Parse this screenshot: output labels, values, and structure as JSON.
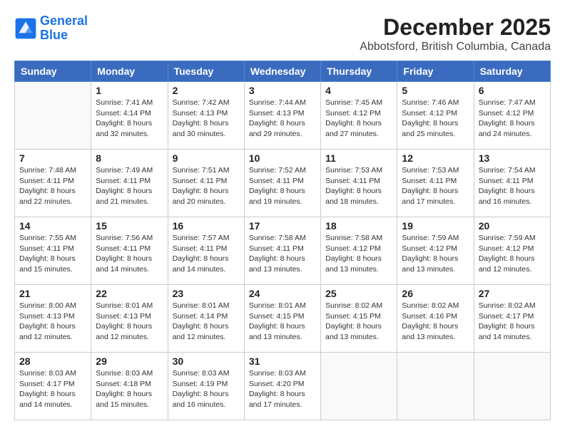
{
  "header": {
    "logo_line1": "General",
    "logo_line2": "Blue",
    "month": "December 2025",
    "location": "Abbotsford, British Columbia, Canada"
  },
  "days_of_week": [
    "Sunday",
    "Monday",
    "Tuesday",
    "Wednesday",
    "Thursday",
    "Friday",
    "Saturday"
  ],
  "weeks": [
    [
      {
        "day": "",
        "info": ""
      },
      {
        "day": "1",
        "info": "Sunrise: 7:41 AM\nSunset: 4:14 PM\nDaylight: 8 hours\nand 32 minutes."
      },
      {
        "day": "2",
        "info": "Sunrise: 7:42 AM\nSunset: 4:13 PM\nDaylight: 8 hours\nand 30 minutes."
      },
      {
        "day": "3",
        "info": "Sunrise: 7:44 AM\nSunset: 4:13 PM\nDaylight: 8 hours\nand 29 minutes."
      },
      {
        "day": "4",
        "info": "Sunrise: 7:45 AM\nSunset: 4:12 PM\nDaylight: 8 hours\nand 27 minutes."
      },
      {
        "day": "5",
        "info": "Sunrise: 7:46 AM\nSunset: 4:12 PM\nDaylight: 8 hours\nand 25 minutes."
      },
      {
        "day": "6",
        "info": "Sunrise: 7:47 AM\nSunset: 4:12 PM\nDaylight: 8 hours\nand 24 minutes."
      }
    ],
    [
      {
        "day": "7",
        "info": "Sunrise: 7:48 AM\nSunset: 4:11 PM\nDaylight: 8 hours\nand 22 minutes."
      },
      {
        "day": "8",
        "info": "Sunrise: 7:49 AM\nSunset: 4:11 PM\nDaylight: 8 hours\nand 21 minutes."
      },
      {
        "day": "9",
        "info": "Sunrise: 7:51 AM\nSunset: 4:11 PM\nDaylight: 8 hours\nand 20 minutes."
      },
      {
        "day": "10",
        "info": "Sunrise: 7:52 AM\nSunset: 4:11 PM\nDaylight: 8 hours\nand 19 minutes."
      },
      {
        "day": "11",
        "info": "Sunrise: 7:53 AM\nSunset: 4:11 PM\nDaylight: 8 hours\nand 18 minutes."
      },
      {
        "day": "12",
        "info": "Sunrise: 7:53 AM\nSunset: 4:11 PM\nDaylight: 8 hours\nand 17 minutes."
      },
      {
        "day": "13",
        "info": "Sunrise: 7:54 AM\nSunset: 4:11 PM\nDaylight: 8 hours\nand 16 minutes."
      }
    ],
    [
      {
        "day": "14",
        "info": "Sunrise: 7:55 AM\nSunset: 4:11 PM\nDaylight: 8 hours\nand 15 minutes."
      },
      {
        "day": "15",
        "info": "Sunrise: 7:56 AM\nSunset: 4:11 PM\nDaylight: 8 hours\nand 14 minutes."
      },
      {
        "day": "16",
        "info": "Sunrise: 7:57 AM\nSunset: 4:11 PM\nDaylight: 8 hours\nand 14 minutes."
      },
      {
        "day": "17",
        "info": "Sunrise: 7:58 AM\nSunset: 4:11 PM\nDaylight: 8 hours\nand 13 minutes."
      },
      {
        "day": "18",
        "info": "Sunrise: 7:58 AM\nSunset: 4:12 PM\nDaylight: 8 hours\nand 13 minutes."
      },
      {
        "day": "19",
        "info": "Sunrise: 7:59 AM\nSunset: 4:12 PM\nDaylight: 8 hours\nand 13 minutes."
      },
      {
        "day": "20",
        "info": "Sunrise: 7:59 AM\nSunset: 4:12 PM\nDaylight: 8 hours\nand 12 minutes."
      }
    ],
    [
      {
        "day": "21",
        "info": "Sunrise: 8:00 AM\nSunset: 4:13 PM\nDaylight: 8 hours\nand 12 minutes."
      },
      {
        "day": "22",
        "info": "Sunrise: 8:01 AM\nSunset: 4:13 PM\nDaylight: 8 hours\nand 12 minutes."
      },
      {
        "day": "23",
        "info": "Sunrise: 8:01 AM\nSunset: 4:14 PM\nDaylight: 8 hours\nand 12 minutes."
      },
      {
        "day": "24",
        "info": "Sunrise: 8:01 AM\nSunset: 4:15 PM\nDaylight: 8 hours\nand 13 minutes."
      },
      {
        "day": "25",
        "info": "Sunrise: 8:02 AM\nSunset: 4:15 PM\nDaylight: 8 hours\nand 13 minutes."
      },
      {
        "day": "26",
        "info": "Sunrise: 8:02 AM\nSunset: 4:16 PM\nDaylight: 8 hours\nand 13 minutes."
      },
      {
        "day": "27",
        "info": "Sunrise: 8:02 AM\nSunset: 4:17 PM\nDaylight: 8 hours\nand 14 minutes."
      }
    ],
    [
      {
        "day": "28",
        "info": "Sunrise: 8:03 AM\nSunset: 4:17 PM\nDaylight: 8 hours\nand 14 minutes."
      },
      {
        "day": "29",
        "info": "Sunrise: 8:03 AM\nSunset: 4:18 PM\nDaylight: 8 hours\nand 15 minutes."
      },
      {
        "day": "30",
        "info": "Sunrise: 8:03 AM\nSunset: 4:19 PM\nDaylight: 8 hours\nand 16 minutes."
      },
      {
        "day": "31",
        "info": "Sunrise: 8:03 AM\nSunset: 4:20 PM\nDaylight: 8 hours\nand 17 minutes."
      },
      {
        "day": "",
        "info": ""
      },
      {
        "day": "",
        "info": ""
      },
      {
        "day": "",
        "info": ""
      }
    ]
  ]
}
